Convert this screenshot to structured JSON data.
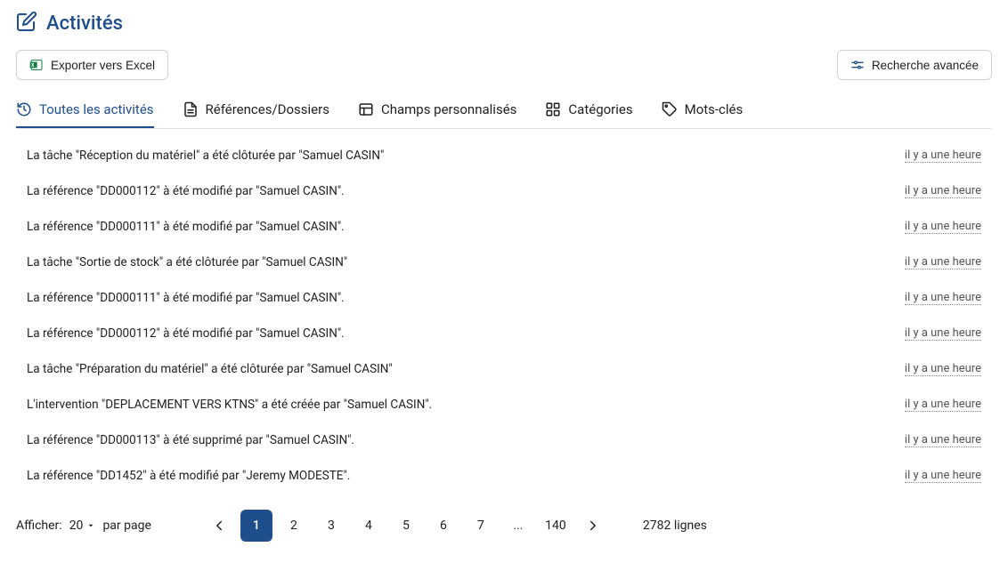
{
  "header": {
    "title": "Activités"
  },
  "toolbar": {
    "export_label": "Exporter vers Excel",
    "search_label": "Recherche avancée"
  },
  "tabs": [
    {
      "label": "Toutes les activités"
    },
    {
      "label": "Références/Dossiers"
    },
    {
      "label": "Champs personnalisés"
    },
    {
      "label": "Catégories"
    },
    {
      "label": "Mots-clés"
    }
  ],
  "activities": [
    {
      "text": "La tâche \"Réception du matériel\" a été clôturée par \"Samuel CASIN\"",
      "time": "il y a une heure"
    },
    {
      "text": "La référence \"DD000112\" à été modifié par \"Samuel CASIN\".",
      "time": "il y a une heure"
    },
    {
      "text": "La référence \"DD000111\" à été modifié par \"Samuel CASIN\".",
      "time": "il y a une heure"
    },
    {
      "text": "La tâche \"Sortie de stock\" a été clôturée par \"Samuel CASIN\"",
      "time": "il y a une heure"
    },
    {
      "text": "La référence \"DD000111\" à été modifié par \"Samuel CASIN\".",
      "time": "il y a une heure"
    },
    {
      "text": "La référence \"DD000112\" à été modifié par \"Samuel CASIN\".",
      "time": "il y a une heure"
    },
    {
      "text": "La tâche \"Préparation du matériel\" a été clôturée par \"Samuel CASIN\"",
      "time": "il y a une heure"
    },
    {
      "text": "L'intervention \"DEPLACEMENT VERS KTNS\" a été créée par \"Samuel CASIN\".",
      "time": "il y a une heure"
    },
    {
      "text": "La référence \"DD000113\" à été supprimé par \"Samuel CASIN\".",
      "time": "il y a une heure"
    },
    {
      "text": "La référence \"DD1452\" à été modifié par \"Jeremy MODESTE\".",
      "time": "il y a une heure"
    }
  ],
  "pagination": {
    "show_label": "Afficher:",
    "page_size": "20",
    "per_page_label": "par page",
    "pages": [
      "1",
      "2",
      "3",
      "4",
      "5",
      "6",
      "7",
      "...",
      "140"
    ],
    "total": "2782 lignes"
  }
}
